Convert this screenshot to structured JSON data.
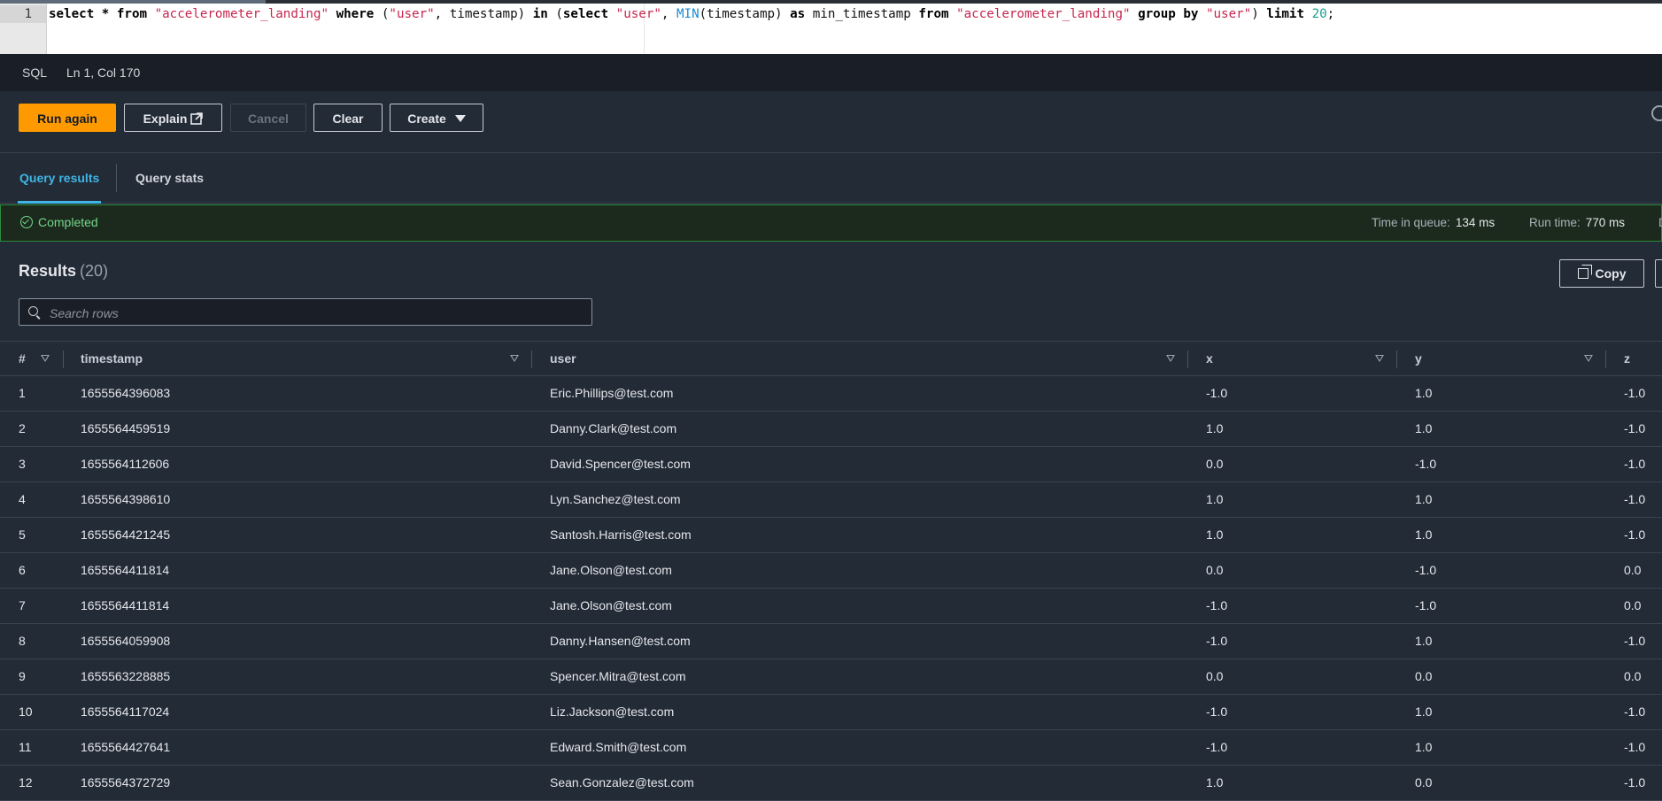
{
  "editor": {
    "line_number": "1",
    "tokens": [
      {
        "t": "select * ",
        "c": "kw"
      },
      {
        "t": "from ",
        "c": "kw"
      },
      {
        "t": "\"accelerometer_landing\"",
        "c": "str"
      },
      {
        "t": " where ",
        "c": "kw"
      },
      {
        "t": "(",
        "c": ""
      },
      {
        "t": "\"user\"",
        "c": "str"
      },
      {
        "t": ", timestamp) ",
        "c": ""
      },
      {
        "t": "in ",
        "c": "kw"
      },
      {
        "t": "(",
        "c": ""
      },
      {
        "t": "select ",
        "c": "kw"
      },
      {
        "t": "\"user\"",
        "c": "str"
      },
      {
        "t": ", ",
        "c": ""
      },
      {
        "t": "MIN",
        "c": "fn"
      },
      {
        "t": "(timestamp) ",
        "c": ""
      },
      {
        "t": "as ",
        "c": "kw"
      },
      {
        "t": "min_timestamp ",
        "c": ""
      },
      {
        "t": "from ",
        "c": "kw"
      },
      {
        "t": "\"accelerometer_landing\"",
        "c": "str"
      },
      {
        "t": " group by ",
        "c": "kw"
      },
      {
        "t": "\"user\"",
        "c": "str"
      },
      {
        "t": ") ",
        "c": ""
      },
      {
        "t": "limit ",
        "c": "kw"
      },
      {
        "t": "20",
        "c": "num"
      },
      {
        "t": ";",
        "c": ""
      }
    ]
  },
  "statusbar": {
    "language": "SQL",
    "position": "Ln 1, Col 170"
  },
  "toolbar": {
    "run_again": "Run again",
    "explain": "Explain",
    "cancel": "Cancel",
    "clear": "Clear",
    "create": "Create"
  },
  "tabs": {
    "query_results": "Query results",
    "query_stats": "Query stats"
  },
  "banner": {
    "status": "Completed",
    "queue_label": "Time in queue:",
    "queue_value": "134 ms",
    "run_label": "Run time:",
    "run_value": "770 ms",
    "extra": "D"
  },
  "results": {
    "title": "Results",
    "count": "(20)",
    "copy": "Copy",
    "search_placeholder": "Search rows"
  },
  "table": {
    "columns": [
      "#",
      "timestamp",
      "user",
      "x",
      "y",
      "z"
    ],
    "rows": [
      [
        "1",
        "1655564396083",
        "Eric.Phillips@test.com",
        "-1.0",
        "1.0",
        "-1.0"
      ],
      [
        "2",
        "1655564459519",
        "Danny.Clark@test.com",
        "1.0",
        "1.0",
        "-1.0"
      ],
      [
        "3",
        "1655564112606",
        "David.Spencer@test.com",
        "0.0",
        "-1.0",
        "-1.0"
      ],
      [
        "4",
        "1655564398610",
        "Lyn.Sanchez@test.com",
        "1.0",
        "1.0",
        "-1.0"
      ],
      [
        "5",
        "1655564421245",
        "Santosh.Harris@test.com",
        "1.0",
        "1.0",
        "-1.0"
      ],
      [
        "6",
        "1655564411814",
        "Jane.Olson@test.com",
        "0.0",
        "-1.0",
        "0.0"
      ],
      [
        "7",
        "1655564411814",
        "Jane.Olson@test.com",
        "-1.0",
        "-1.0",
        "0.0"
      ],
      [
        "8",
        "1655564059908",
        "Danny.Hansen@test.com",
        "-1.0",
        "1.0",
        "-1.0"
      ],
      [
        "9",
        "1655563228885",
        "Spencer.Mitra@test.com",
        "0.0",
        "0.0",
        "0.0"
      ],
      [
        "10",
        "1655564117024",
        "Liz.Jackson@test.com",
        "-1.0",
        "1.0",
        "-1.0"
      ],
      [
        "11",
        "1655564427641",
        "Edward.Smith@test.com",
        "-1.0",
        "1.0",
        "-1.0"
      ],
      [
        "12",
        "1655564372729",
        "Sean.Gonzalez@test.com",
        "1.0",
        "0.0",
        "-1.0"
      ]
    ]
  }
}
